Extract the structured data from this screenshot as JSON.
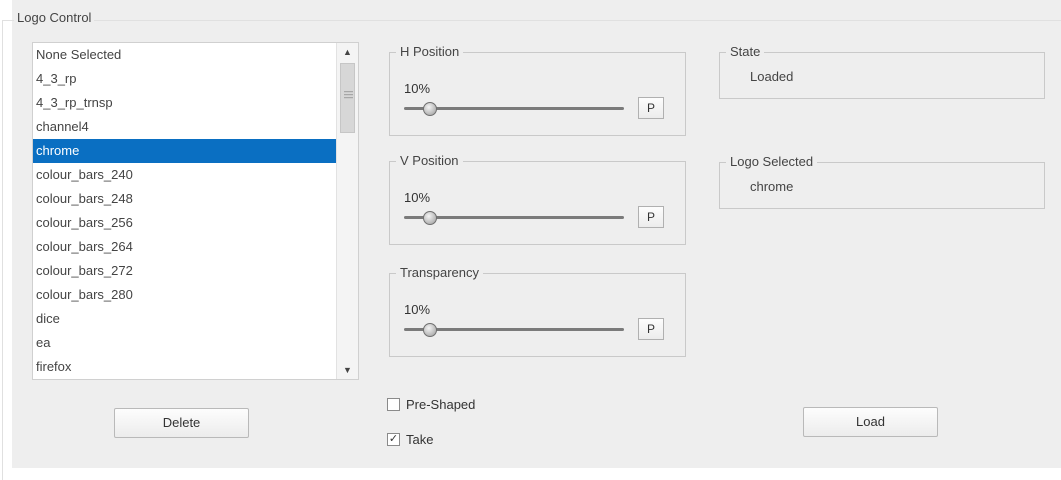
{
  "logo_control": {
    "title": "Logo Control",
    "list": {
      "items": [
        "None Selected",
        "4_3_rp",
        "4_3_rp_trnsp",
        "channel4",
        "chrome",
        "colour_bars_240",
        "colour_bars_248",
        "colour_bars_256",
        "colour_bars_264",
        "colour_bars_272",
        "colour_bars_280",
        "dice",
        "ea",
        "firefox"
      ],
      "selected_index": 4
    },
    "delete_label": "Delete",
    "h_position": {
      "title": "H Position",
      "value": "10%",
      "slider_fraction": 0.1,
      "p_label": "P"
    },
    "v_position": {
      "title": "V Position",
      "value": "10%",
      "slider_fraction": 0.1,
      "p_label": "P"
    },
    "transparency": {
      "title": "Transparency",
      "value": "10%",
      "slider_fraction": 0.1,
      "p_label": "P"
    },
    "pre_shaped": {
      "label": "Pre-Shaped",
      "checked": false
    },
    "take": {
      "label": "Take",
      "checked": true
    },
    "state": {
      "title": "State",
      "value": "Loaded"
    },
    "logo_selected": {
      "title": "Logo Selected",
      "value": "chrome"
    },
    "load_label": "Load",
    "colors": {
      "selection": "#0a6fc2",
      "panel": "#eeeeee"
    }
  }
}
